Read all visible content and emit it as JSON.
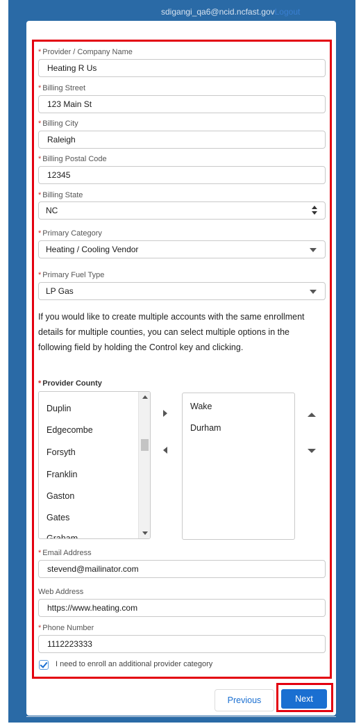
{
  "header": {
    "user_email": "sdigangi_qa6@ncid.ncfast.gov",
    "user_link": "Logout"
  },
  "form": {
    "provider_name": {
      "label": "Provider / Company Name",
      "value": "Heating R Us"
    },
    "billing_street": {
      "label": "Billing Street",
      "value": "123 Main St"
    },
    "billing_city": {
      "label": "Billing City",
      "value": "Raleigh"
    },
    "billing_postal": {
      "label": "Billing Postal Code",
      "value": "12345"
    },
    "billing_state": {
      "label": "Billing State",
      "value": "NC"
    },
    "primary_category": {
      "label": "Primary Category",
      "value": "Heating / Cooling Vendor"
    },
    "primary_fuel": {
      "label": "Primary Fuel Type",
      "value": "LP Gas"
    },
    "help_text": "If you would like to create multiple accounts with the same enrollment details for multiple counties, you can select multiple options in the following field by holding the Control key and clicking.",
    "county": {
      "label": "Provider County",
      "available": [
        "Duplin",
        "Edgecombe",
        "Forsyth",
        "Franklin",
        "Gaston",
        "Gates",
        "Graham"
      ],
      "selected": [
        "Wake",
        "Durham"
      ]
    },
    "email": {
      "label": "Email Address",
      "value": "stevend@mailinator.com"
    },
    "web": {
      "label": "Web Address",
      "value": "https://www.heating.com"
    },
    "phone": {
      "label": "Phone Number",
      "value": "1112223333"
    },
    "additional_category": {
      "label": "I need to enroll an additional provider category",
      "checked": true
    }
  },
  "buttons": {
    "previous": "Previous",
    "next": "Next"
  },
  "colors": {
    "page_bg": "#2a6aa6",
    "highlight": "#e3000f",
    "brand_blue": "#1a6fd1",
    "required": "#c23934"
  }
}
